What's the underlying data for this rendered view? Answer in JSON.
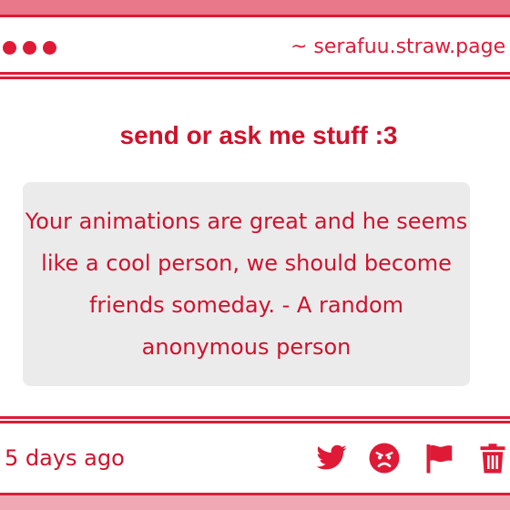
{
  "browser": {
    "url": "~ serafuu.straw.page"
  },
  "post": {
    "heading": "send or ask me stuff :3",
    "message": "Your animations are great and he seems like a cool person, we should become friends someday. - A random anonymous person",
    "timestamp": "5 days ago"
  },
  "actions": [
    {
      "icon": "twitter-bird-icon"
    },
    {
      "icon": "angry-face-icon"
    },
    {
      "icon": "flag-icon"
    },
    {
      "icon": "trash-icon"
    }
  ],
  "colors": {
    "accent": "#df1a36",
    "text": "#d0112b",
    "message_bg": "#ecebec",
    "top_band": "#e8788a",
    "bottom_band": "#f0a9b4"
  }
}
